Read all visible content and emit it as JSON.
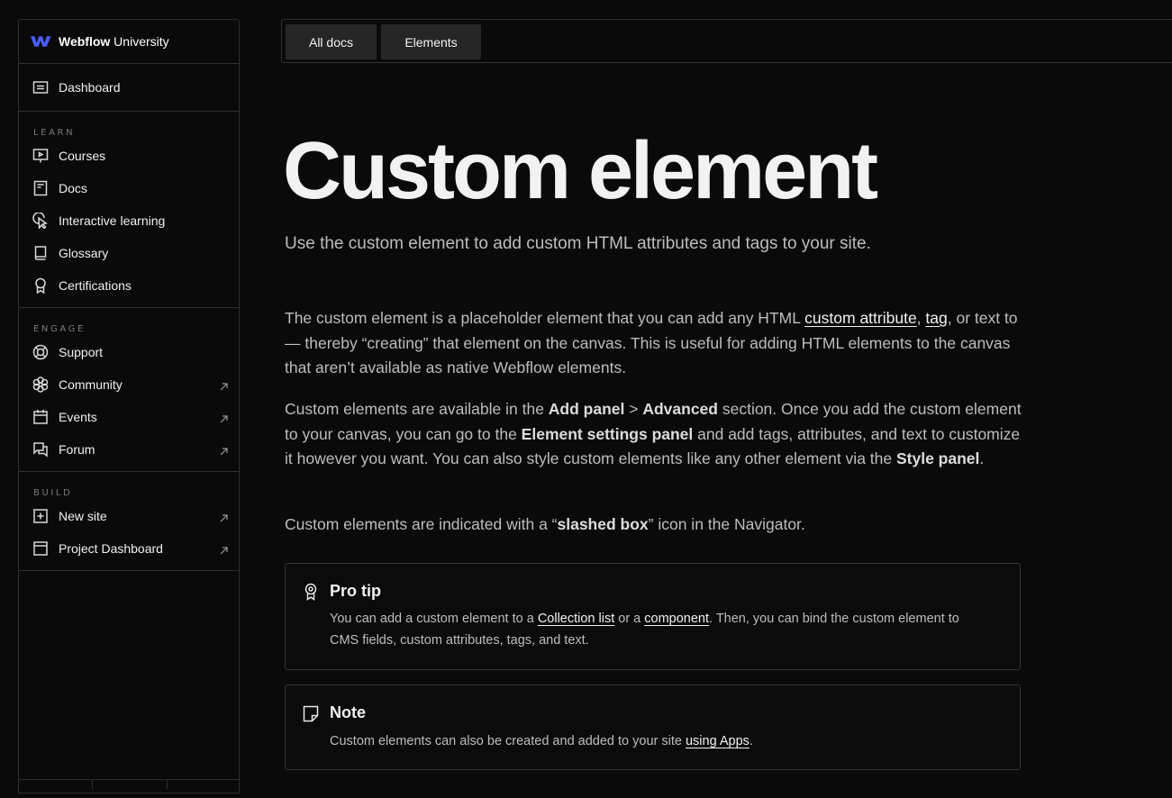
{
  "brand": {
    "name_bold": "Webflow",
    "name_rest": " University"
  },
  "sidebar": {
    "dashboard": "Dashboard",
    "learn_label": "LEARN",
    "learn": [
      {
        "label": "Courses",
        "icon": "presentation-icon"
      },
      {
        "label": "Docs",
        "icon": "document-icon"
      },
      {
        "label": "Interactive learning",
        "icon": "cursor-click-icon"
      },
      {
        "label": "Glossary",
        "icon": "book-icon"
      },
      {
        "label": "Certifications",
        "icon": "award-icon"
      }
    ],
    "engage_label": "ENGAGE",
    "engage": [
      {
        "label": "Support",
        "icon": "lifebuoy-icon"
      },
      {
        "label": "Community",
        "icon": "flower-icon"
      },
      {
        "label": "Events",
        "icon": "calendar-icon"
      },
      {
        "label": "Forum",
        "icon": "chat-icon"
      }
    ],
    "build_label": "BUILD",
    "build": [
      {
        "label": "New site",
        "icon": "plus-square-icon"
      },
      {
        "label": "Project Dashboard",
        "icon": "window-icon"
      }
    ]
  },
  "tabs": {
    "all_docs": "All docs",
    "elements": "Elements"
  },
  "page": {
    "title": "Custom element",
    "subtitle": "Use the custom element to add custom HTML attributes and tags to your site.",
    "p1": {
      "t1": "The custom element is a placeholder element that you can add any HTML ",
      "link1": "custom attribute",
      "t2": ", ",
      "link2": "tag",
      "t3": ", or text to — thereby “creating” that element on the canvas. This is useful for adding HTML elements to the canvas that aren’t available as native Webflow elements."
    },
    "p2": {
      "t1": "Custom elements are available in the ",
      "b1": "Add panel",
      "t2": " > ",
      "b2": "Advanced",
      "t3": " section. Once you add the custom element to your canvas, you can go to the ",
      "b3": "Element settings panel",
      "t4": " and add tags, attributes, and text to customize it however you want. You can also style custom elements like any other element via the ",
      "b4": "Style panel",
      "t5": "."
    },
    "p3": {
      "t1": "Custom elements are indicated with a “",
      "b1": "slashed box",
      "t2": "” icon in the Navigator."
    },
    "tip": {
      "title": "Pro tip",
      "t1": "You can add a custom element to a ",
      "link1": "Collection list",
      "t2": " or a ",
      "link2": "component",
      "t3": ". Then, you can bind the custom element to CMS fields, custom attributes, tags, and text."
    },
    "note": {
      "title": "Note",
      "t1": "Custom elements can also be created and added to your site ",
      "link1": "using Apps",
      "t2": "."
    }
  }
}
